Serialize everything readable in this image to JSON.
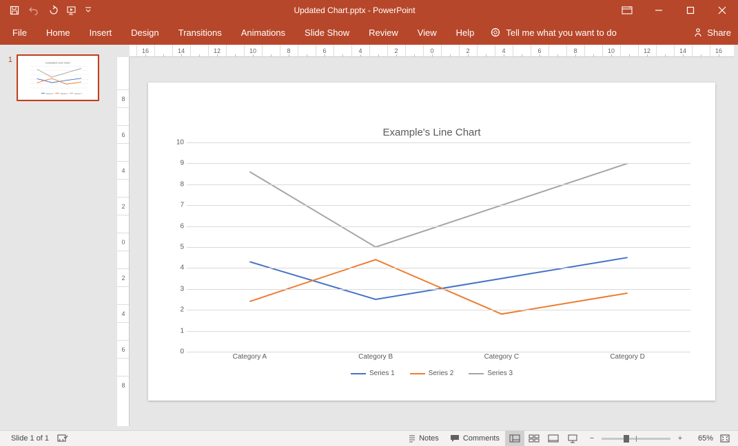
{
  "title": "Updated Chart.pptx  -  PowerPoint",
  "ribbon_tabs": [
    "File",
    "Home",
    "Insert",
    "Design",
    "Transitions",
    "Animations",
    "Slide Show",
    "Review",
    "View",
    "Help"
  ],
  "tell_me": "Tell me what you want to do",
  "share_label": "Share",
  "thumb_number": "1",
  "status": {
    "slide_of": "Slide 1 of 1",
    "notes": "Notes",
    "comments": "Comments",
    "zoom_pct": "65%"
  },
  "ruler_h": [
    "16",
    "",
    "14",
    "",
    "12",
    "",
    "10",
    "",
    "8",
    "",
    "6",
    "",
    "4",
    "",
    "2",
    "",
    "0",
    "",
    "2",
    "",
    "4",
    "",
    "6",
    "",
    "8",
    "",
    "10",
    "",
    "12",
    "",
    "14",
    "",
    "16"
  ],
  "ruler_v": [
    "8",
    "",
    "6",
    "",
    "4",
    "",
    "2",
    "",
    "0",
    "",
    "2",
    "",
    "4",
    "",
    "6",
    "",
    "8"
  ],
  "chart_data": {
    "type": "line",
    "title": "Example's Line Chart",
    "categories": [
      "Category A",
      "Category B",
      "Category C",
      "Category D"
    ],
    "series": [
      {
        "name": "Series 1",
        "color": "#4472c4",
        "values": [
          4.3,
          2.5,
          3.5,
          4.5
        ]
      },
      {
        "name": "Series 2",
        "color": "#ed7d31",
        "values": [
          2.4,
          4.4,
          1.8,
          2.8
        ]
      },
      {
        "name": "Series 3",
        "color": "#a5a5a5",
        "values": [
          8.6,
          5.0,
          7.0,
          9.0
        ]
      }
    ],
    "ylim": [
      0,
      10
    ],
    "yticks": [
      0,
      1,
      2,
      3,
      4,
      5,
      6,
      7,
      8,
      9,
      10
    ],
    "xlabel": "",
    "ylabel": ""
  },
  "colors": {
    "brand": "#b7472a"
  }
}
